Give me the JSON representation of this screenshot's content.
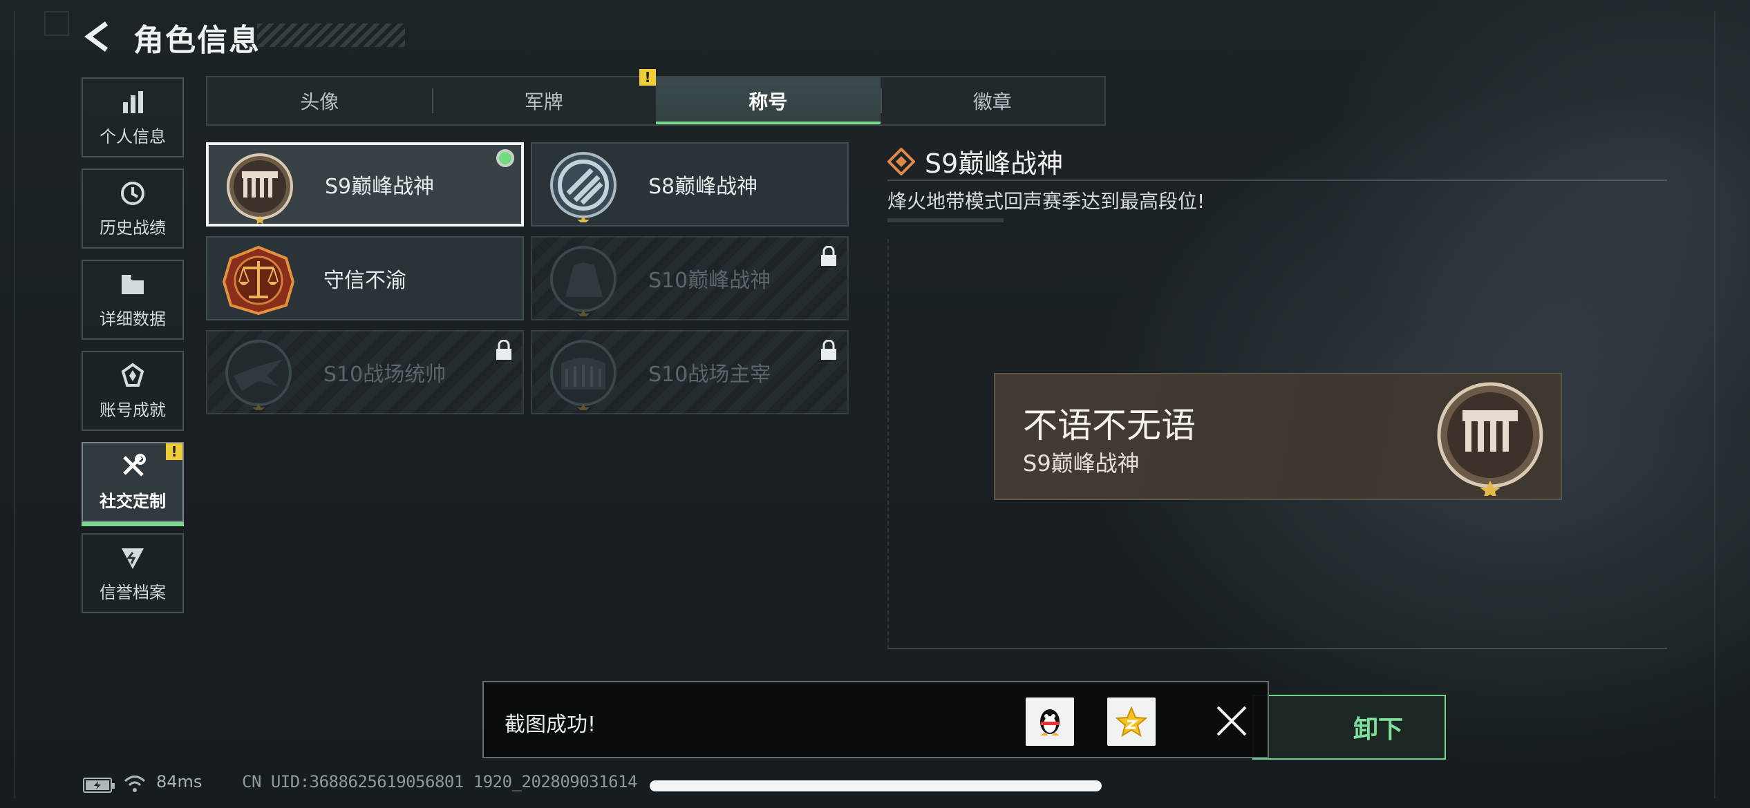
{
  "header": {
    "title": "角色信息"
  },
  "sidebar": {
    "items": [
      {
        "label": "个人信息",
        "icon": "bar-chart-icon"
      },
      {
        "label": "历史战绩",
        "icon": "history-clock-icon"
      },
      {
        "label": "详细数据",
        "icon": "folder-icon"
      },
      {
        "label": "账号成就",
        "icon": "achievement-icon"
      },
      {
        "label": "社交定制",
        "icon": "tools-icon",
        "active": true,
        "badge": "!"
      },
      {
        "label": "信誉档案",
        "icon": "reputation-icon"
      }
    ]
  },
  "tabs": [
    {
      "label": "头像"
    },
    {
      "label": "军牌",
      "badge": "!"
    },
    {
      "label": "称号",
      "active": true
    },
    {
      "label": "徽章"
    }
  ],
  "titles": [
    {
      "name": "S9巅峰战神",
      "selected": true,
      "equipped": true,
      "locked": false
    },
    {
      "name": "S8巅峰战神",
      "locked": false
    },
    {
      "name": "守信不渝",
      "locked": false
    },
    {
      "name": "S10巅峰战神",
      "locked": true
    },
    {
      "name": "S10战场统帅",
      "locked": true
    },
    {
      "name": "S10战场主宰",
      "locked": true
    }
  ],
  "detail": {
    "title": "S9巅峰战神",
    "description": "烽火地带模式回声赛季达到最高段位!"
  },
  "preview": {
    "player_name": "不语不无语",
    "title": "S9巅峰战神"
  },
  "unequip_button": {
    "label": "卸下"
  },
  "toast": {
    "message": "截图成功!"
  },
  "status": {
    "ping": "84ms",
    "uid": "CN UID:3688625619056801 1920_202809031614"
  },
  "colors": {
    "accent_green": "#7ad88e",
    "warning_yellow": "#efce3a",
    "medal_gold": "#e2b94a"
  }
}
